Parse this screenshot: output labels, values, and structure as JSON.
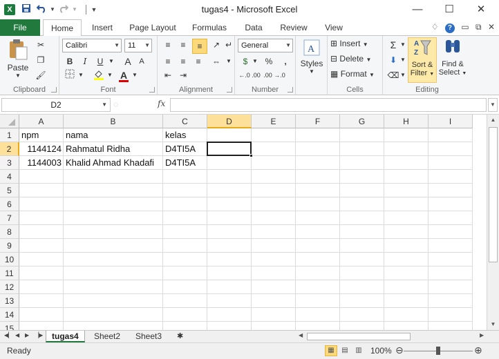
{
  "window": {
    "title": "tugas4  -  Microsoft Excel",
    "logo_letter": "X"
  },
  "qat": {
    "save_icon": "save-icon",
    "undo_icon": "undo-icon",
    "redo_icon": "redo-icon"
  },
  "tabs": [
    {
      "label": "File"
    },
    {
      "label": "Home"
    },
    {
      "label": "Insert"
    },
    {
      "label": "Page Layout"
    },
    {
      "label": "Formulas"
    },
    {
      "label": "Data"
    },
    {
      "label": "Review"
    },
    {
      "label": "View"
    }
  ],
  "ribbon": {
    "clipboard": {
      "label": "Clipboard",
      "paste": "Paste"
    },
    "font": {
      "label": "Font",
      "name": "Calibri",
      "size": "11",
      "bold": "B",
      "italic": "I",
      "underline": "U",
      "grow": "A",
      "shrink": "A",
      "color_letter": "A"
    },
    "alignment": {
      "label": "Alignment"
    },
    "number": {
      "label": "Number",
      "format": "General",
      "currency": "$",
      "percent": "%",
      "comma": ",",
      "inc_dec": "←.0 .00",
      "dec_dec": ".00 →.0"
    },
    "styles": {
      "label": "",
      "button": "Styles"
    },
    "cells": {
      "label": "Cells",
      "insert": "Insert",
      "delete": "Delete",
      "format": "Format"
    },
    "editing": {
      "label": "Editing",
      "sort_line1": "Sort &",
      "sort_line2": "Filter",
      "find_line1": "Find &",
      "find_line2": "Select"
    }
  },
  "formula_bar": {
    "name_box": "D2",
    "fx": "fx",
    "formula": ""
  },
  "columns": [
    "A",
    "B",
    "C",
    "D",
    "E",
    "F",
    "G",
    "H",
    "I"
  ],
  "rows": [
    "1",
    "2",
    "3",
    "4",
    "5",
    "6",
    "7",
    "8",
    "9",
    "10",
    "11",
    "12",
    "13",
    "14",
    "15"
  ],
  "cells": {
    "A1": "npm",
    "B1": "nama",
    "C1": "kelas",
    "A2": "1144124",
    "B2": "Rahmatul Ridha",
    "C2": "D4TI5A",
    "A3": "1144003",
    "B3": "Khalid Ahmad Khadafi",
    "C3": "D4TI5A"
  },
  "active_cell": "D2",
  "sheets": [
    {
      "name": "tugas4",
      "active": true
    },
    {
      "name": "Sheet2",
      "active": false
    },
    {
      "name": "Sheet3",
      "active": false
    }
  ],
  "status": {
    "mode": "Ready",
    "zoom": "100%"
  }
}
